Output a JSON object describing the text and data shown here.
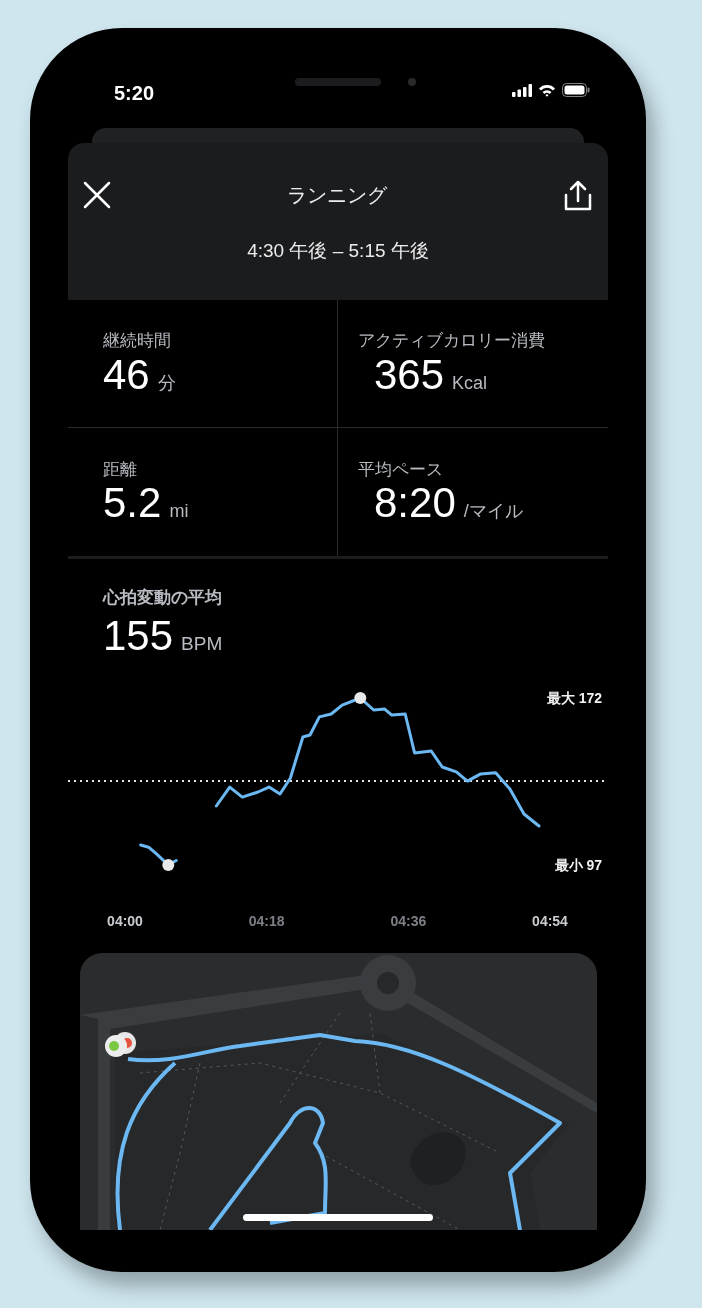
{
  "status_bar": {
    "time": "5:20"
  },
  "header": {
    "title": "ランニング",
    "time_range": "4:30 午後 – 5:15 午後"
  },
  "stats": [
    {
      "label": "継続時間",
      "value": "46",
      "unit": "分"
    },
    {
      "label": "アクティブカロリー消費",
      "value": "365",
      "unit": "Kcal"
    },
    {
      "label": "距離",
      "value": "5.2",
      "unit": "mi"
    },
    {
      "label": "平均ペース",
      "value": "8:20",
      "unit": "/マイル"
    }
  ],
  "heart_rate": {
    "title": "心拍変動の平均",
    "value": "155",
    "unit": "BPM",
    "max_label": "最大 172",
    "min_label": "最小 97",
    "time_labels": [
      "04:00",
      "04:18",
      "04:36",
      "04:54"
    ]
  }
}
